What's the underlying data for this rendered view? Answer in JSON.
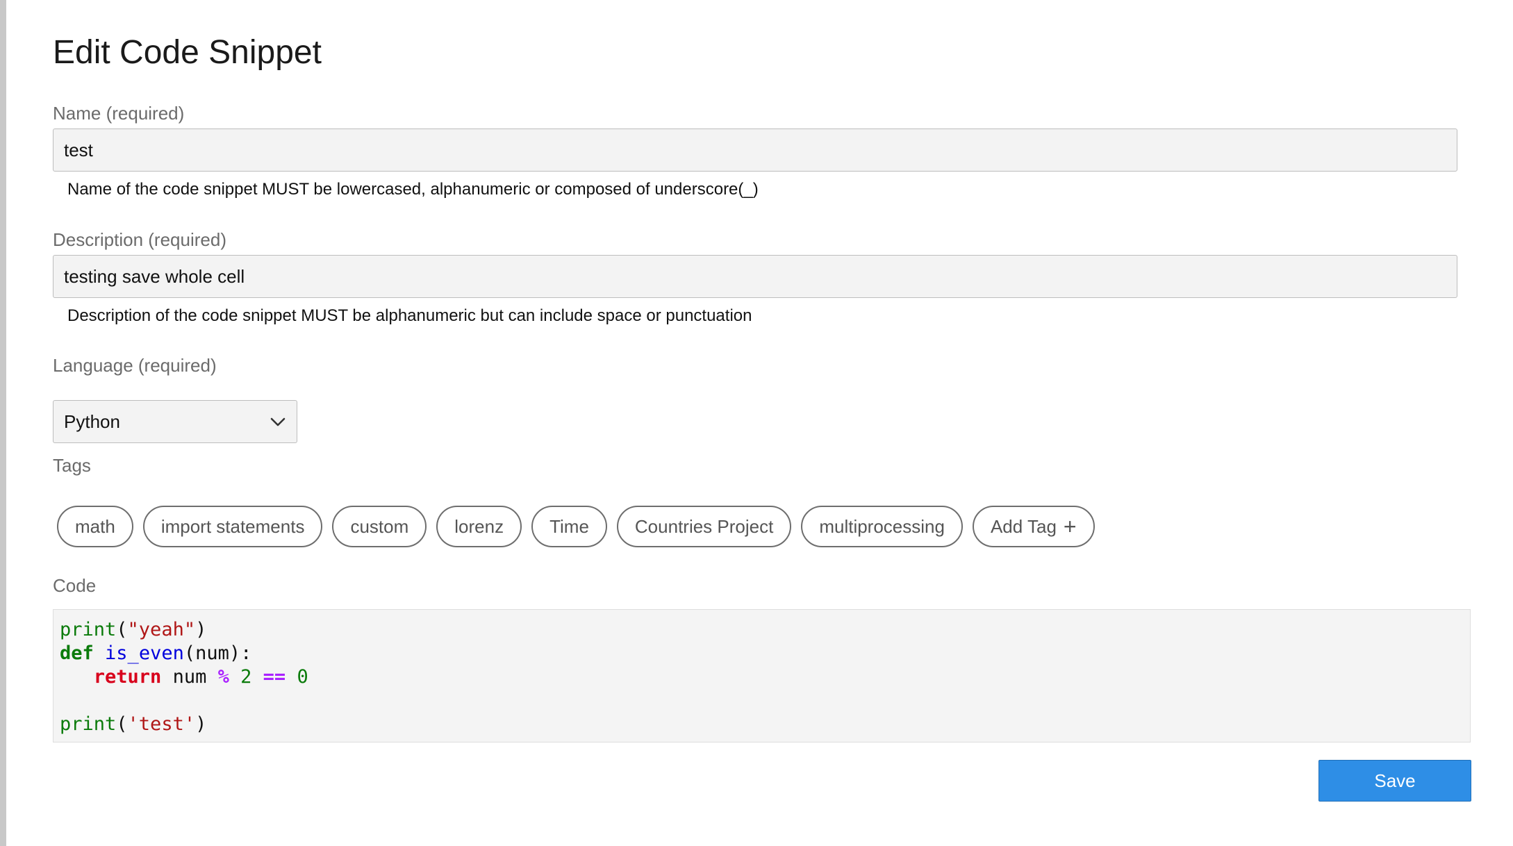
{
  "form": {
    "title": "Edit Code Snippet",
    "name": {
      "label": "Name (required)",
      "value": "test",
      "help": "Name of the code snippet MUST be lowercased, alphanumeric or composed of underscore(_)"
    },
    "description": {
      "label": "Description (required)",
      "value": "testing save whole cell",
      "help": "Description of the code snippet MUST be alphanumeric but can include space or punctuation"
    },
    "language": {
      "label": "Language (required)",
      "selected": "Python",
      "icon": "chevron-down-icon"
    },
    "tags": {
      "label": "Tags",
      "items": [
        "math",
        "import statements",
        "custom",
        "lorenz",
        "Time",
        "Countries Project",
        "multiprocessing"
      ],
      "add_label": "Add Tag",
      "add_icon": "+"
    },
    "code": {
      "label": "Code",
      "lines": [
        [
          {
            "t": "print",
            "k": "builtin"
          },
          {
            "t": "(",
            "k": "plain"
          },
          {
            "t": "\"yeah\"",
            "k": "string"
          },
          {
            "t": ")",
            "k": "plain"
          }
        ],
        [
          {
            "t": "def",
            "k": "keyword"
          },
          {
            "t": " ",
            "k": "plain"
          },
          {
            "t": "is_even",
            "k": "func"
          },
          {
            "t": "(num):",
            "k": "plain"
          }
        ],
        [
          {
            "t": "   ",
            "k": "plain"
          },
          {
            "t": "return",
            "k": "keyword2"
          },
          {
            "t": " num ",
            "k": "plain"
          },
          {
            "t": "%",
            "k": "op"
          },
          {
            "t": " ",
            "k": "plain"
          },
          {
            "t": "2",
            "k": "num"
          },
          {
            "t": " ",
            "k": "plain"
          },
          {
            "t": "==",
            "k": "op"
          },
          {
            "t": " ",
            "k": "plain"
          },
          {
            "t": "0",
            "k": "num"
          }
        ],
        [],
        [
          {
            "t": "print",
            "k": "builtin"
          },
          {
            "t": "(",
            "k": "plain"
          },
          {
            "t": "'test'",
            "k": "string"
          },
          {
            "t": ")",
            "k": "plain"
          }
        ]
      ]
    },
    "save_label": "Save"
  },
  "colors": {
    "accent": "#2e8ee6",
    "input_bg": "#f3f3f3",
    "label": "#6b6b6b"
  }
}
